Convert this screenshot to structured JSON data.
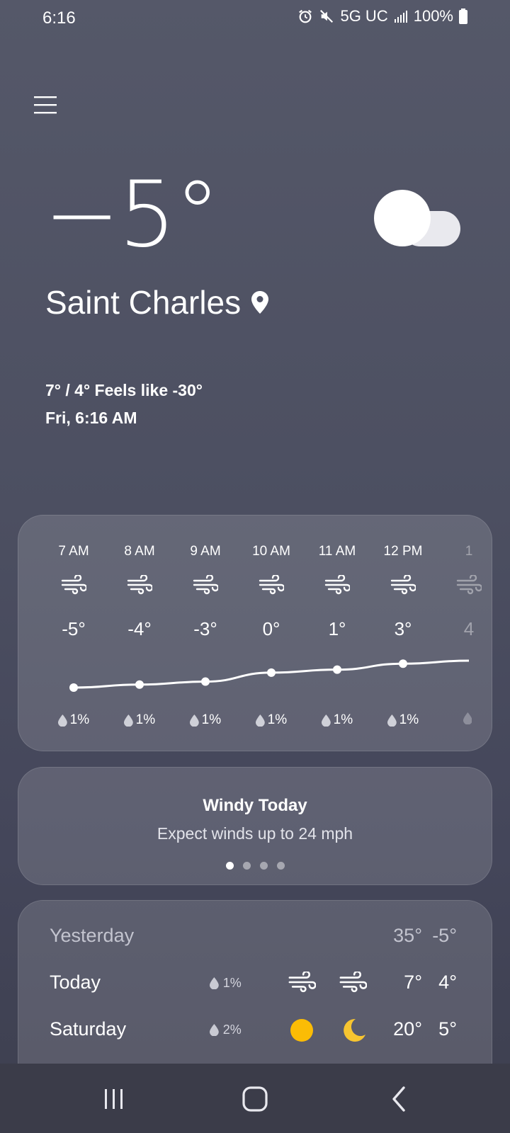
{
  "status_bar": {
    "time": "6:16",
    "network": "5G UC",
    "battery": "100%",
    "icons": [
      "alarm-icon",
      "mute-icon",
      "signal-icon",
      "battery-icon"
    ]
  },
  "current": {
    "temperature": "−5°",
    "condition_icon": "cloud-icon",
    "city": "Saint Charles",
    "hi_lo_feels": "7° / 4° Feels like -30°",
    "datetime": "Fri, 6:16 AM"
  },
  "hourly": {
    "hours": [
      {
        "time": "7 AM",
        "temp": "-5°",
        "precip": "1%",
        "value": -5
      },
      {
        "time": "8 AM",
        "temp": "-4°",
        "precip": "1%",
        "value": -4
      },
      {
        "time": "9 AM",
        "temp": "-3°",
        "precip": "1%",
        "value": -3
      },
      {
        "time": "10 AM",
        "temp": "0°",
        "precip": "1%",
        "value": 0
      },
      {
        "time": "11 AM",
        "temp": "1°",
        "precip": "1%",
        "value": 1
      },
      {
        "time": "12 PM",
        "temp": "3°",
        "precip": "1%",
        "value": 3
      },
      {
        "time": "1",
        "temp": "4",
        "precip": "",
        "value": 4
      }
    ]
  },
  "alert": {
    "title": "Windy Today",
    "subtitle": "Expect winds up to 24 mph",
    "pages": 4,
    "active_page": 0
  },
  "daily": [
    {
      "day": "Yesterday",
      "precip": "",
      "icon_day": "",
      "icon_night": "",
      "high": "35°",
      "low": "-5°"
    },
    {
      "day": "Today",
      "precip": "1%",
      "icon_day": "wind-icon",
      "icon_night": "wind-icon",
      "high": "7°",
      "low": "4°"
    },
    {
      "day": "Saturday",
      "precip": "2%",
      "icon_day": "sun-icon",
      "icon_night": "moon-icon",
      "high": "20°",
      "low": "5°"
    }
  ],
  "colors": {
    "sun": "#FBBC05",
    "moon": "#F7C530",
    "background_top": "#555869",
    "background_bottom": "#3d3f4f"
  }
}
